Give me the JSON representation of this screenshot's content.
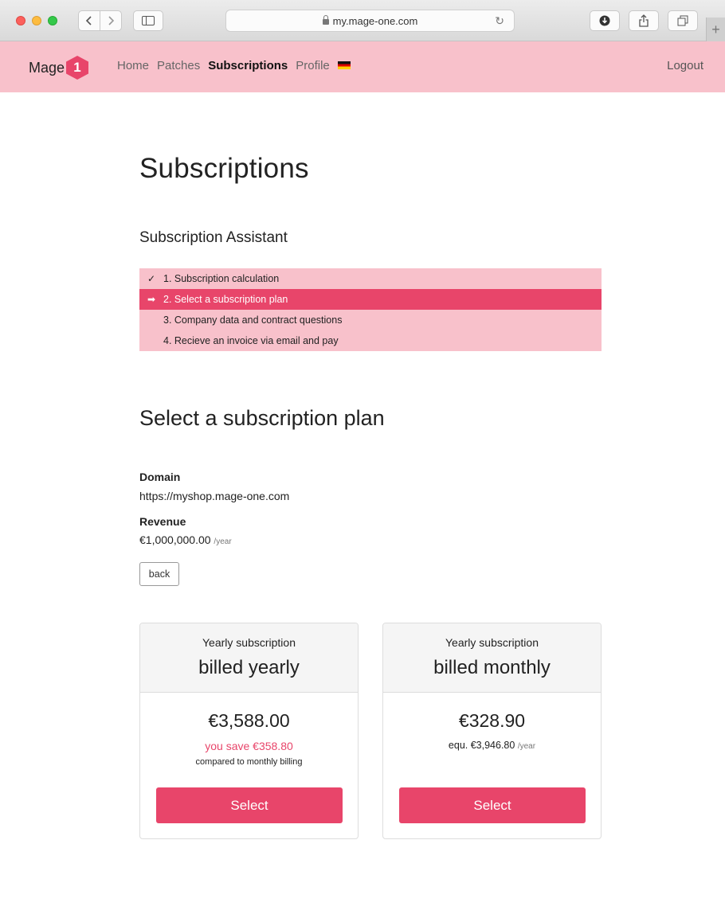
{
  "browser": {
    "url": "my.mage-one.com"
  },
  "nav": {
    "logo_text": "Mage",
    "logo_badge": "1",
    "links": [
      "Home",
      "Patches",
      "Subscriptions",
      "Profile"
    ],
    "active_link": "Subscriptions",
    "logout": "Logout",
    "language_flag": "de-flag-icon"
  },
  "page": {
    "title": "Subscriptions"
  },
  "assistant": {
    "title": "Subscription Assistant",
    "steps": [
      {
        "mark": "✓",
        "label": "1. Subscription calculation",
        "state": "done"
      },
      {
        "mark": "➡",
        "label": "2. Select a subscription plan",
        "state": "current"
      },
      {
        "mark": "",
        "label": "3. Company data and contract questions",
        "state": "pending"
      },
      {
        "mark": "",
        "label": "4. Recieve an invoice via email and pay",
        "state": "pending"
      }
    ]
  },
  "plan": {
    "title": "Select a subscription plan",
    "domain_label": "Domain",
    "domain_value": "https://myshop.mage-one.com",
    "revenue_label": "Revenue",
    "revenue_value": "€1,000,000.00",
    "revenue_unit": "/year",
    "back_label": "back"
  },
  "cards": [
    {
      "subtitle": "Yearly subscription",
      "title": "billed yearly",
      "price": "€3,588.00",
      "save": "you save €358.80",
      "note": "compared to monthly billing",
      "button": "Select"
    },
    {
      "subtitle": "Yearly subscription",
      "title": "billed monthly",
      "price": "€328.90",
      "equ": "equ. €3,946.80",
      "equ_unit": "/year",
      "button": "Select"
    }
  ],
  "colors": {
    "accent": "#e8456a",
    "nav_bg": "#f8c1cb"
  }
}
